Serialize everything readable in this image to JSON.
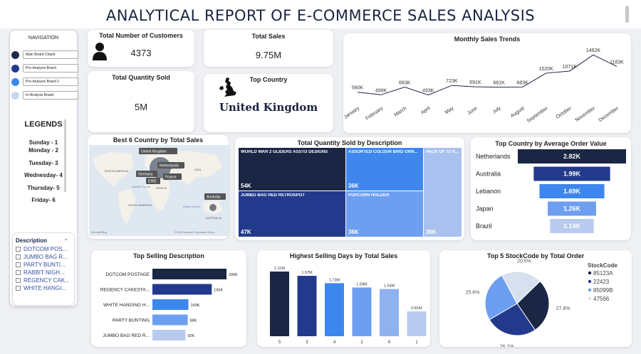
{
  "header": {
    "title": "ANALYTICAL REPORT OF E-COMMERCE SALES ANALYSIS"
  },
  "navigation": {
    "title": "NAVIGATION",
    "items": [
      {
        "label": "Main Board Charts",
        "color": "#1f2a4a"
      },
      {
        "label": "Pre-Analysis Board",
        "color": "#26398f"
      },
      {
        "label": "Pre-Analysis Board 2",
        "color": "#3d86ee"
      },
      {
        "label": "In-Analysis Board",
        "color": "#c9d6ef"
      }
    ]
  },
  "legends": {
    "title": "LEGENDS",
    "items": [
      "Sunday -  1",
      "Monday - 2",
      "Tuesday- 3",
      "Wednesday- 4",
      "Thursday- 5",
      "Friday-  6"
    ]
  },
  "slicer": {
    "title": "Description",
    "items": [
      "DOTCOM POS...",
      "JUMBO BAG R...",
      "PARTY BUNTI...",
      "RABBIT NIGH...",
      "REGENCY CAK...",
      "WHITE HANGI..."
    ]
  },
  "kpis": {
    "customers": {
      "label": "Total Number of Customers",
      "value": "4373"
    },
    "sales": {
      "label": "Total Sales",
      "value": "9.75M"
    },
    "quantity": {
      "label": "Total Quantity Sold",
      "value": "5M"
    },
    "country": {
      "label": "Top Country",
      "value": "United Kingdom"
    }
  },
  "map": {
    "title": "Best 6 Country by Total Sales",
    "labels": [
      "United Kingdom",
      "Netherlands",
      "Germany",
      "France",
      "EIRE",
      "Australia"
    ],
    "geo_labels": [
      "NORTH AMERICA",
      "EUROPE",
      "ASIA",
      "AFRICA",
      "SOUTH AMERICA",
      "Atlantic Ocean",
      "Indian Ocean",
      "AUSTRALIA"
    ],
    "credit": "Microsoft Bing",
    "copyright": "© 2023 Microsoft Corporation  Terms"
  },
  "treemap": {
    "title": "Total Quantity Sold by Description",
    "cells": [
      {
        "label": "WORLD WAR 2 GLIDERS ASSTD DESIGNS",
        "value": "54K",
        "color": "#1a2644"
      },
      {
        "label": "JUMBO BAG RED RETROSPOT",
        "value": "47K",
        "color": "#233a8c"
      },
      {
        "label": "ASSORTED COLOUR BIRD ORN...",
        "value": "36K",
        "color": "#3f87ee"
      },
      {
        "label": "POPCORN HOLDER",
        "value": "36K",
        "color": "#6d9ff0"
      },
      {
        "label": "PACK OF 72 R...",
        "value": "36K",
        "color": "#a9c1ee"
      }
    ]
  },
  "funnel": {
    "title": "Top Country by Average Order Value",
    "items": [
      {
        "country": "Netherlands",
        "label": "2.82K",
        "value": 2.82,
        "color": "#1a2644"
      },
      {
        "country": "Australia",
        "label": "1.99K",
        "value": 1.99,
        "color": "#233a8c"
      },
      {
        "country": "Lebanon",
        "label": "1.69K",
        "value": 1.69,
        "color": "#3d86ee"
      },
      {
        "country": "Japan",
        "label": "1.26K",
        "value": 1.26,
        "color": "#6d9ff0"
      },
      {
        "country": "Brazil",
        "label": "1.14K",
        "value": 1.14,
        "color": "#b8cbee"
      }
    ]
  },
  "colors": {
    "dark": "#1a2644",
    "navy": "#233a8c",
    "blue": "#3d86ee",
    "mid": "#6d9ff0",
    "light": "#b8cbee"
  },
  "chart_data": [
    {
      "type": "line",
      "title": "Monthly Sales Trends",
      "categories": [
        "January",
        "February",
        "March",
        "April",
        "May",
        "June",
        "July",
        "August",
        "September",
        "October",
        "November",
        "December"
      ],
      "values": [
        560,
        498,
        683,
        493,
        723,
        691,
        681,
        683,
        1020,
        1071,
        1462,
        1183
      ],
      "labels": [
        "560K",
        "498K",
        "683K",
        "493K",
        "723K",
        "691K",
        "681K",
        "683K",
        "1020K",
        "1071K",
        "1462K",
        "1183K"
      ]
    },
    {
      "type": "bar",
      "orientation": "horizontal",
      "title": "Top Selling Description",
      "categories": [
        "DOTCOM POSTAGE",
        "REGENCY CAKESTA...",
        "WHITE HANGING H...",
        "PARTY BUNTING",
        "JUMBO BAG RED R..."
      ],
      "values": [
        206,
        165,
        100,
        98,
        92
      ],
      "labels": [
        "206K",
        "165K",
        "100K",
        "98K",
        "92K"
      ]
    },
    {
      "type": "bar",
      "title": "Highest Selling Days by Total Sales",
      "categories": [
        "5",
        "3",
        "4",
        "2",
        "6",
        "1"
      ],
      "values": [
        2.11,
        1.97,
        1.73,
        1.59,
        1.54,
        0.81
      ],
      "labels": [
        "2.11M",
        "1.97M",
        "1.73M",
        "1.59M",
        "1.54M",
        "0.81M"
      ]
    },
    {
      "type": "pie",
      "title": "Top 5  StockCode by Total Order",
      "legend_title": "StockCode",
      "categories": [
        "85123A",
        "22423",
        "85099B",
        "47566"
      ],
      "values": [
        27.8,
        26.1,
        25.6,
        20.5
      ],
      "labels": [
        "27.8%",
        "26.1%",
        "25.6%",
        "20.5%"
      ]
    }
  ]
}
